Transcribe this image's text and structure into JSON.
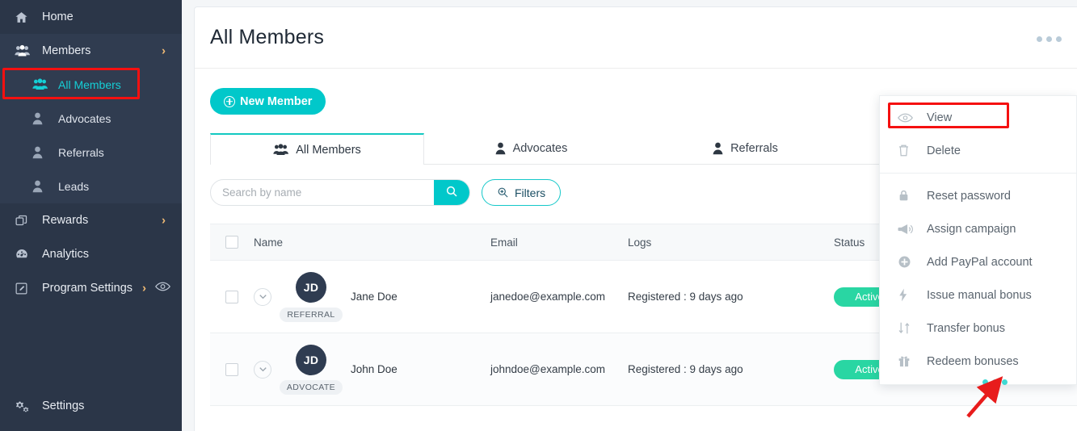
{
  "sidebar": {
    "items": [
      {
        "label": "Home",
        "icon": "home-icon"
      },
      {
        "label": "Members",
        "icon": "members-group-icon",
        "chevron": "›"
      },
      {
        "label": "Rewards",
        "icon": "rewards-icon",
        "chevron": "›"
      },
      {
        "label": "Analytics",
        "icon": "analytics-gauge-icon"
      },
      {
        "label": "Program Settings",
        "icon": "program-settings-pencil-icon",
        "chevron": "›",
        "extra_icon": "eye-icon"
      }
    ],
    "members_submenu": [
      {
        "label": "All Members",
        "icon": "members-group-icon",
        "active": true
      },
      {
        "label": "Advocates",
        "icon": "user-icon",
        "active": false
      },
      {
        "label": "Referrals",
        "icon": "user-icon",
        "active": false
      },
      {
        "label": "Leads",
        "icon": "user-icon",
        "active": false
      }
    ],
    "settings": {
      "label": "Settings",
      "icon": "gears-icon"
    },
    "accent_active": "#15cfd6",
    "background": "#2b3648",
    "submenu_background": "#303c50"
  },
  "header": {
    "title": "All Members",
    "overflow_icon": "three-dots-icon"
  },
  "toolbar": {
    "new_member_label": "New Member",
    "new_member_icon": "plus-circle-icon",
    "new_member_color": "#01c8ca"
  },
  "tabs": [
    {
      "label": "All Members",
      "icon": "members-group-icon",
      "selected": true
    },
    {
      "label": "Advocates",
      "icon": "user-icon",
      "selected": false
    },
    {
      "label": "Referrals",
      "icon": "user-icon",
      "selected": false
    }
  ],
  "search": {
    "placeholder": "Search by name",
    "value": "",
    "button_icon": "search-icon",
    "filters_label": "Filters",
    "filters_icon": "filter-zoom-icon"
  },
  "table": {
    "columns": [
      "Name",
      "Email",
      "Logs",
      "Status"
    ],
    "rows": [
      {
        "initials": "JD",
        "role": "REFERRAL",
        "name": "Jane Doe",
        "email": "janedoe@example.com",
        "logs": "Registered : 9 days ago",
        "status": "Active"
      },
      {
        "initials": "JD",
        "role": "ADVOCATE",
        "name": "John Doe",
        "email": "johndoe@example.com",
        "logs": "Registered : 9 days ago",
        "status": "Active"
      }
    ],
    "status_color": "#29d6a3",
    "row_menu_icon": "three-dots-icon"
  },
  "dropdown": {
    "items": [
      {
        "label": "View",
        "icon": "eye-icon",
        "highlighted": true
      },
      {
        "label": "Delete",
        "icon": "trash-icon",
        "highlighted": false
      },
      {
        "label": "Reset password",
        "icon": "lock-icon",
        "highlighted": false
      },
      {
        "label": "Assign campaign",
        "icon": "megaphone-icon",
        "highlighted": false
      },
      {
        "label": "Add PayPal account",
        "icon": "plus-circle-icon",
        "highlighted": false
      },
      {
        "label": "Issue manual bonus",
        "icon": "lightning-bolt-icon",
        "highlighted": false
      },
      {
        "label": "Transfer bonus",
        "icon": "transfer-arrows-icon",
        "highlighted": false
      },
      {
        "label": "Redeem bonuses",
        "icon": "gift-icon",
        "highlighted": false
      }
    ]
  },
  "annotations": {
    "highlight_color": "#f51010",
    "arrow_color": "#e81c1c",
    "arrow_target": "row-overflow-menu"
  }
}
